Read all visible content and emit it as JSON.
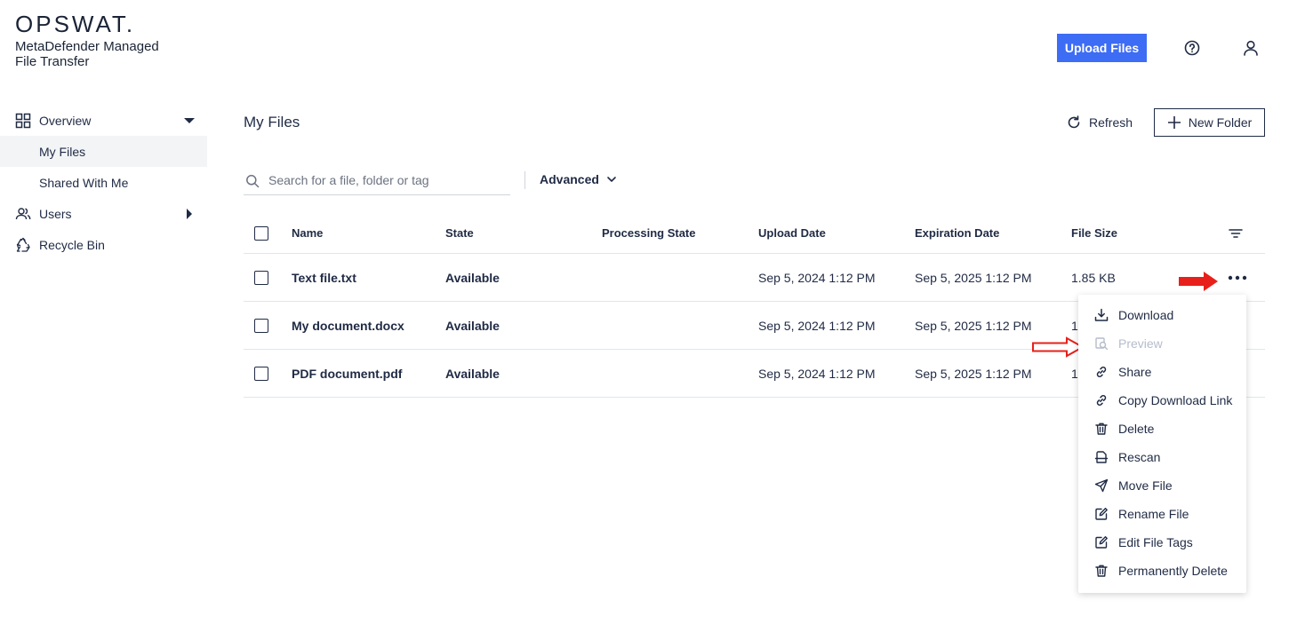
{
  "header": {
    "logo_text": "OPSWAT.",
    "app_name": "MetaDefender Managed File Transfer",
    "upload_label": "Upload Files",
    "help_icon": "help-circle-icon",
    "user_icon": "user-icon"
  },
  "sidebar": {
    "items": [
      {
        "label": "Overview",
        "icon": "grid-icon"
      },
      {
        "label": "My Files"
      },
      {
        "label": "Shared With Me"
      },
      {
        "label": "Users",
        "icon": "users-icon"
      },
      {
        "label": "Recycle Bin",
        "icon": "recycle-icon"
      }
    ]
  },
  "main": {
    "title": "My Files",
    "refresh_label": "Refresh",
    "new_folder_label": "New Folder",
    "search_placeholder": "Search for a file, folder or tag",
    "advanced_label": "Advanced"
  },
  "table": {
    "columns": [
      "Name",
      "State",
      "Processing State",
      "Upload Date",
      "Expiration Date",
      "File Size"
    ],
    "rows": [
      {
        "name": "Text file.txt",
        "state": "Available",
        "processing": "",
        "upload": "Sep 5, 2024 1:12 PM",
        "expiration": "Sep 5, 2025 1:12 PM",
        "size": "1.85 KB"
      },
      {
        "name": "My document.docx",
        "state": "Available",
        "processing": "",
        "upload": "Sep 5, 2024 1:12 PM",
        "expiration": "Sep 5, 2025 1:12 PM",
        "size": "1"
      },
      {
        "name": "PDF document.pdf",
        "state": "Available",
        "processing": "",
        "upload": "Sep 5, 2024 1:12 PM",
        "expiration": "Sep 5, 2025 1:12 PM",
        "size": "1"
      }
    ]
  },
  "context_menu": {
    "items": [
      {
        "label": "Download",
        "icon": "download-icon"
      },
      {
        "label": "Preview",
        "icon": "preview-icon"
      },
      {
        "label": "Share",
        "icon": "link-icon"
      },
      {
        "label": "Copy Download Link",
        "icon": "link-icon"
      },
      {
        "label": "Delete",
        "icon": "trash-icon"
      },
      {
        "label": "Rescan",
        "icon": "rescan-icon"
      },
      {
        "label": "Move File",
        "icon": "send-icon"
      },
      {
        "label": "Rename File",
        "icon": "edit-icon"
      },
      {
        "label": "Edit File Tags",
        "icon": "edit-icon"
      },
      {
        "label": "Permanently Delete",
        "icon": "trash-icon"
      }
    ]
  },
  "colors": {
    "accent": "#3d6cf5",
    "text": "#1f2a44",
    "arrow_red": "#e8201b",
    "disabled": "#b5bccb"
  }
}
